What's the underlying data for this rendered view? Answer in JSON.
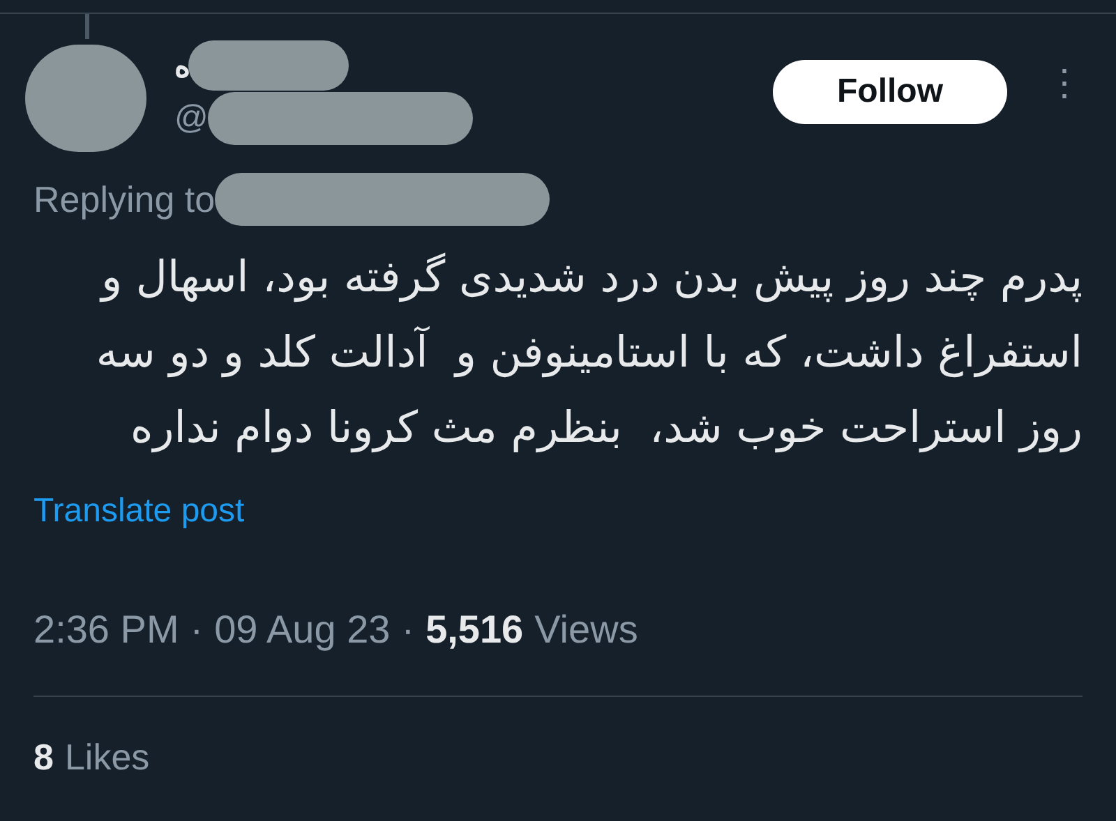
{
  "author": {
    "name": "ه",
    "handle_prefix": "@"
  },
  "follow_button": "Follow",
  "more_icon": "⋮",
  "reply": {
    "label": "Replying to"
  },
  "text_lines": [
    "پدرم چند روز پیش بدن درد شدیدی گرفته بود، اسهال و",
    "استفراغ داشت، که با استامینوفن و  آدالت کلد و دو سه",
    "روز استراحت خوب شد،  بنظرم مث کرونا دوام نداره"
  ],
  "translate": "Translate post",
  "meta": {
    "time": "2:36 PM",
    "date": "09 Aug 23",
    "views_count": "5,516",
    "views_label": "Views",
    "separator": "·"
  },
  "likes": {
    "count": "8",
    "label": "Likes"
  }
}
